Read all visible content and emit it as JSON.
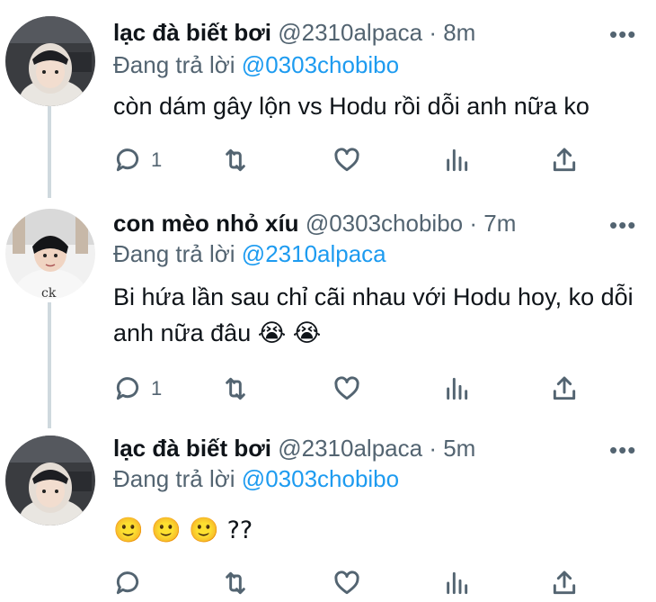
{
  "tweets": [
    {
      "name": "lạc đà biết bơi",
      "handle": "@2310alpaca",
      "dot": "·",
      "time": "8m",
      "reply_label": "Đang trả lời",
      "reply_to": "@0303chobibo",
      "text": "còn dám gây lộn vs Hodu rồi dỗi anh nữa ko",
      "reply_count": "1",
      "more": "•••"
    },
    {
      "name": "con mèo nhỏ xíu",
      "handle": "@0303chobibo",
      "dot": "·",
      "time": "7m",
      "reply_label": "Đang trả lời",
      "reply_to": "@2310alpaca",
      "text": " Bi hứa lần sau chỉ cãi nhau với Hodu hoy, ko dỗi anh nữa đâu 😭 😭",
      "reply_count": "1",
      "more": "•••"
    },
    {
      "name": "lạc đà biết bơi",
      "handle": "@2310alpaca",
      "dot": "·",
      "time": "5m",
      "reply_label": "Đang trả lời",
      "reply_to": "@0303chobibo",
      "text": "🙂 🙂 🙂  ??",
      "reply_count": "",
      "more": "•••"
    }
  ],
  "icons": [
    "reply-icon",
    "retweet-icon",
    "like-icon",
    "analytics-icon",
    "share-icon",
    "more-icon"
  ],
  "colors": {
    "mention": "#1d9bf0",
    "secondary": "#536471",
    "thread_line": "#cfd9de"
  }
}
